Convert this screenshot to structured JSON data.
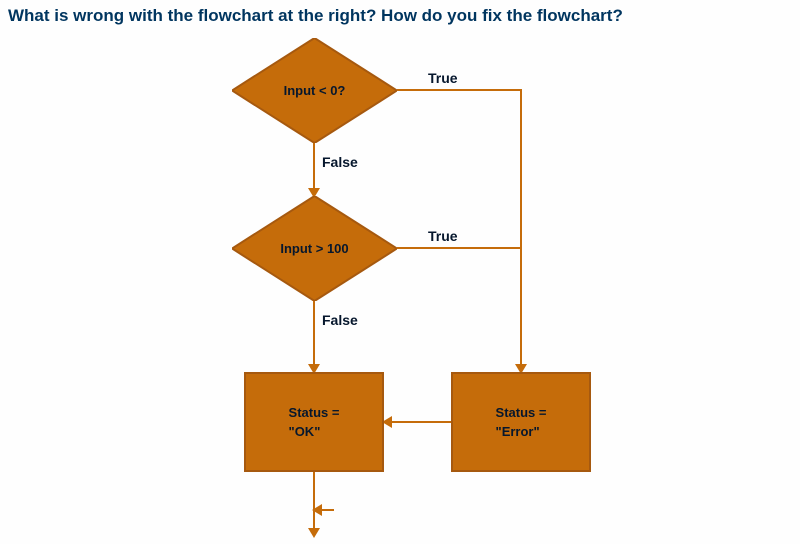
{
  "question": "What is wrong with the flowchart at the right?  How do you fix the flowchart?",
  "flowchart": {
    "color": "#C56C0A",
    "decisions": [
      {
        "id": "d1",
        "text": "Input < 0?"
      },
      {
        "id": "d2",
        "text": "Input > 100"
      }
    ],
    "processes": [
      {
        "id": "p1",
        "text": "Status =\n\"OK\""
      },
      {
        "id": "p2",
        "text": "Status =\n\"Error\""
      }
    ],
    "edges": [
      {
        "from": "d1",
        "label": "True"
      },
      {
        "from": "d1",
        "label": "False"
      },
      {
        "from": "d2",
        "label": "True"
      },
      {
        "from": "d2",
        "label": "False"
      }
    ]
  }
}
